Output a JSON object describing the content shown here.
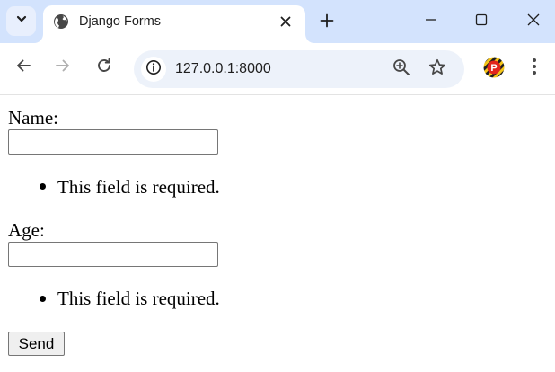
{
  "browser": {
    "tab": {
      "title": "Django Forms",
      "favicon": "globe-icon"
    },
    "address_bar": {
      "url": "127.0.0.1:8000"
    },
    "profile_avatar_letter": "P",
    "colors": {
      "tabstrip": "#d3e3fd",
      "omnibox": "#edf2fa",
      "icon": "#474747",
      "avatar_ring_red": "#e2251b",
      "avatar_ring_yellow": "#f5c518"
    }
  },
  "form": {
    "fields": [
      {
        "label": "Name:",
        "value": "",
        "errors": [
          "This field is required."
        ]
      },
      {
        "label": "Age:",
        "value": "",
        "errors": [
          "This field is required."
        ]
      }
    ],
    "submit_label": "Send"
  }
}
